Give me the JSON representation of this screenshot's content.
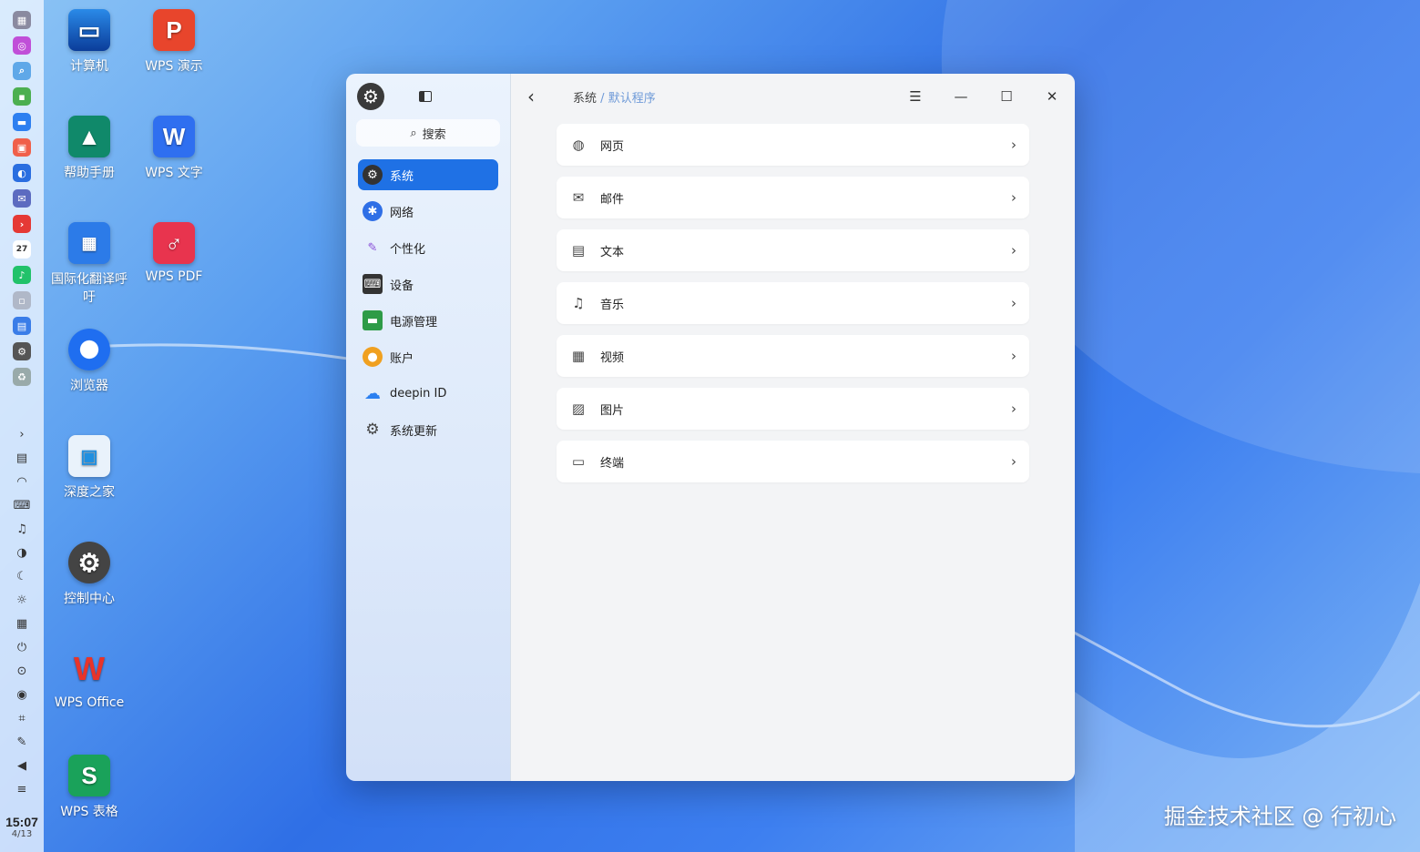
{
  "dock": {
    "clock_time": "15:07",
    "clock_date": "4/13"
  },
  "desktop_icons": [
    {
      "label": "计算机"
    },
    {
      "label": "WPS 演示",
      "glyph": "P"
    },
    {
      "label": "帮助手册"
    },
    {
      "label": "WPS 文字",
      "glyph": "W"
    },
    {
      "label": "国际化翻译呼吁"
    },
    {
      "label": "WPS PDF"
    },
    {
      "label": "浏览器"
    },
    {
      "label": "深度之家"
    },
    {
      "label": "控制中心"
    },
    {
      "label": "WPS Office"
    },
    {
      "label": "WPS 表格",
      "glyph": "S"
    }
  ],
  "sidebar": {
    "search_label": "搜索",
    "items": [
      {
        "label": "系统",
        "icon": "system-icon"
      },
      {
        "label": "网络",
        "icon": "network-icon"
      },
      {
        "label": "个性化",
        "icon": "personalization-icon"
      },
      {
        "label": "设备",
        "icon": "device-icon"
      },
      {
        "label": "电源管理",
        "icon": "power-icon"
      },
      {
        "label": "账户",
        "icon": "account-icon"
      },
      {
        "label": "deepin ID",
        "icon": "cloud-icon"
      },
      {
        "label": "系统更新",
        "icon": "update-icon"
      }
    ]
  },
  "header": {
    "breadcrumb_parent": "系统",
    "breadcrumb_sep": "/",
    "breadcrumb_current": "默认程序"
  },
  "defaults": [
    {
      "label": "网页",
      "icon": "globe-icon"
    },
    {
      "label": "邮件",
      "icon": "mail-icon"
    },
    {
      "label": "文本",
      "icon": "text-icon"
    },
    {
      "label": "音乐",
      "icon": "music-icon"
    },
    {
      "label": "视频",
      "icon": "video-icon"
    },
    {
      "label": "图片",
      "icon": "image-icon"
    },
    {
      "label": "终端",
      "icon": "terminal-icon"
    }
  ],
  "watermark": "掘金技术社区 @ 行初心"
}
